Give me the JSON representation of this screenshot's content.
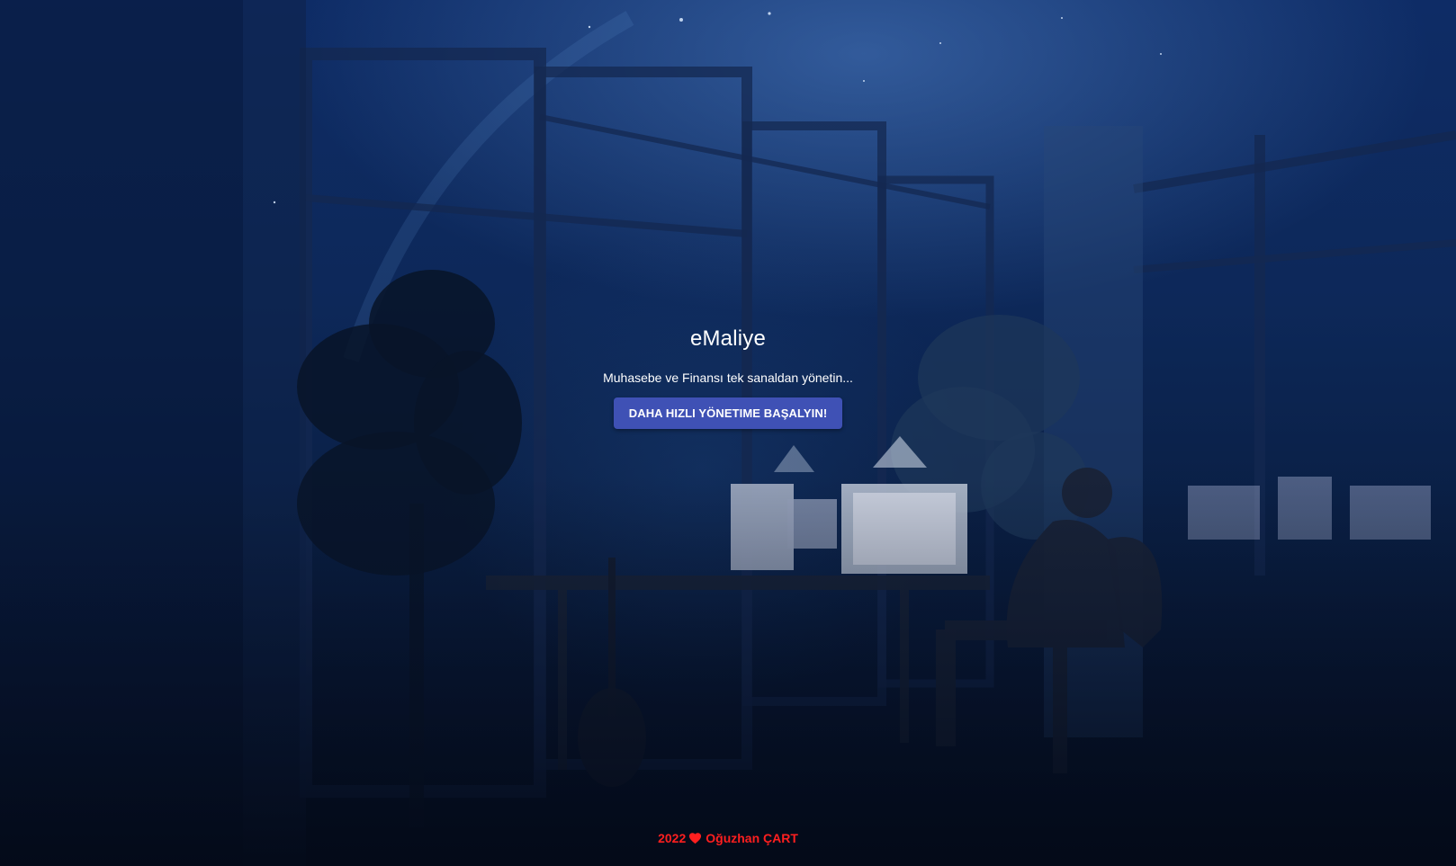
{
  "hero": {
    "title": "eMaliye",
    "subtitle": "Muhasebe ve Finansı tek sanaldan yönetin...",
    "cta_label": "DAHA HIZLI YÖNETIME BAŞALYIN!"
  },
  "footer": {
    "year": "2022",
    "icon": "heart-icon",
    "author": "Oğuzhan ÇART"
  },
  "colors": {
    "cta_background": "#3f51b5",
    "footer_text": "#ff1f1f",
    "background_dark": "#061127"
  }
}
